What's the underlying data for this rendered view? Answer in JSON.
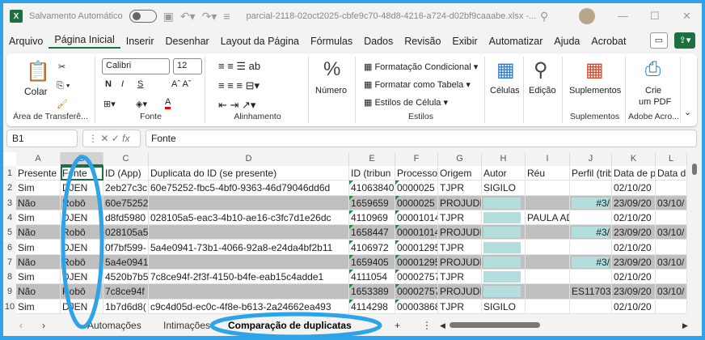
{
  "titlebar": {
    "autosave_label": "Salvamento Automático",
    "filename": "parcial-2118-02oct2025-cbfe9c70-48d8-4216-a724-d02bf9caaabe.xlsx  -..."
  },
  "menu": [
    "Arquivo",
    "Página Inicial",
    "Inserir",
    "Desenhar",
    "Layout da Página",
    "Fórmulas",
    "Dados",
    "Revisão",
    "Exibir",
    "Automatizar",
    "Ajuda",
    "Acrobat"
  ],
  "ribbon": {
    "clipboard": {
      "paste": "Colar",
      "label": "Área de Transferê..."
    },
    "font": {
      "name": "Calibri",
      "size": "12",
      "bold": "N",
      "italic": "I",
      "underline": "S",
      "label": "Fonte"
    },
    "alignment": {
      "label": "Alinhamento"
    },
    "number": {
      "label": "Número"
    },
    "styles": {
      "cond": "Formatação Condicional",
      "table": "Formatar como Tabela",
      "cell": "Estilos de Célula",
      "label": "Estilos"
    },
    "cells": {
      "label": "Células"
    },
    "editing": {
      "label": "Edição"
    },
    "addins": {
      "button": "Suplementos",
      "label": "Suplementos"
    },
    "adobe": {
      "button1": "Crie",
      "button2": "um PDF",
      "label": "Adobe Acro..."
    }
  },
  "formula_bar": {
    "name_box": "B1",
    "fx": "fx",
    "content": "Fonte"
  },
  "columns": [
    "A",
    "B",
    "C",
    "D",
    "E",
    "F",
    "G",
    "H",
    "I",
    "J",
    "K",
    "L"
  ],
  "rows": [
    [
      "Presente",
      "Fonte",
      "ID (App)",
      "Duplicata do ID (se presente)",
      "ID (tribun",
      "Processo",
      "Origem",
      "Autor",
      "Réu",
      "Perfil (trib",
      "Data de p",
      "Data d"
    ],
    [
      "Sim",
      "DJEN",
      "2eb27c3c",
      "60e75252-fbc5-4bf0-9363-46d79046dd6d",
      "41063840",
      "0000025",
      "TJPR",
      "SIGILO",
      "",
      "",
      "02/10/20",
      ""
    ],
    [
      "Não",
      "Robô",
      "60e75252",
      "",
      "1659659",
      "0000025",
      "PROJUDI/",
      "#",
      "",
      "#3/",
      "23/09/20",
      "03/10/"
    ],
    [
      "Sim",
      "DJEN",
      "d8fd5980",
      "028105a5-eac3-4b10-ae16-c3fc7d1e26dc",
      "4110969",
      "00001014",
      "TJPR",
      "#",
      "PAULA AD",
      "",
      "02/10/20",
      ""
    ],
    [
      "Não",
      "Robô",
      "028105a5",
      "",
      "1658447",
      "00001014",
      "PROJUDI/",
      "#",
      "",
      "#3/",
      "23/09/20",
      "03/10/"
    ],
    [
      "Sim",
      "DJEN",
      "0f7bf599-",
      "5a4e0941-73b1-4066-92a8-e24da4bf2b11",
      "4106972",
      "00001295",
      "TJPR",
      "#",
      "",
      "",
      "02/10/20",
      ""
    ],
    [
      "Não",
      "Robô",
      "5a4e0941",
      "",
      "1659405",
      "00001295",
      "PROJUDI/",
      "#",
      "",
      "#3/",
      "23/09/20",
      "03/10/"
    ],
    [
      "Sim",
      "DJEN",
      "4520b7b5",
      "7c8ce94f-2f3f-4150-b4fe-eab15c4adde1",
      "4111054",
      "00002757",
      "TJPR",
      "#",
      "",
      "",
      "02/10/20",
      ""
    ],
    [
      "Não",
      "Robô",
      "7c8ce94f",
      "",
      "1653389",
      "00002757",
      "PROJUDI/",
      "#",
      "",
      "ES11703/",
      "23/09/20",
      "03/10/"
    ],
    [
      "Sim",
      "DJEN",
      "1b7d6d8(",
      "c9c4d05d-ec0c-4f8e-b613-2a24662ea493",
      "4114298",
      "00003868",
      "TJPR",
      "SIGILO",
      "",
      "",
      "02/10/20",
      ""
    ]
  ],
  "sheet_tabs": [
    "Automações",
    "Intimações",
    "Comparação de duplicatas"
  ],
  "active_sheet": "Comparação de duplicatas",
  "colors": {
    "accent": "#1d6f42",
    "annotation": "#2ea3e8",
    "redaction": "#b4dedd",
    "alt_row": "#bfbfbf"
  }
}
